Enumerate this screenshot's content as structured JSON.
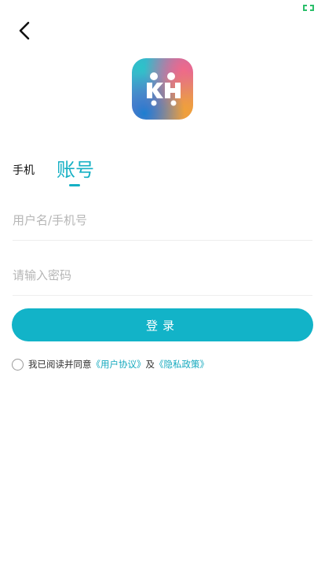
{
  "status_bar": {
    "battery_icon": "battery-icon",
    "accent": "#2bbf6a"
  },
  "nav": {
    "back_icon": "chevron-left-icon"
  },
  "logo": {
    "icon": "app-logo-icon",
    "text": "KH"
  },
  "tabs": {
    "phone_label": "手机",
    "account_label": "账号",
    "active_color": "#15b0c4"
  },
  "form": {
    "username_placeholder": "用户名/手机号",
    "username_value": "",
    "password_placeholder": "请输入密码",
    "password_value": "",
    "login_label": "登录",
    "button_color": "#12b3c8"
  },
  "agreement": {
    "prefix": "我已阅读并同意",
    "user_agreement": "《用户协议》",
    "conjunction": "及",
    "privacy_policy": "《隐私政策》",
    "checked": false
  }
}
